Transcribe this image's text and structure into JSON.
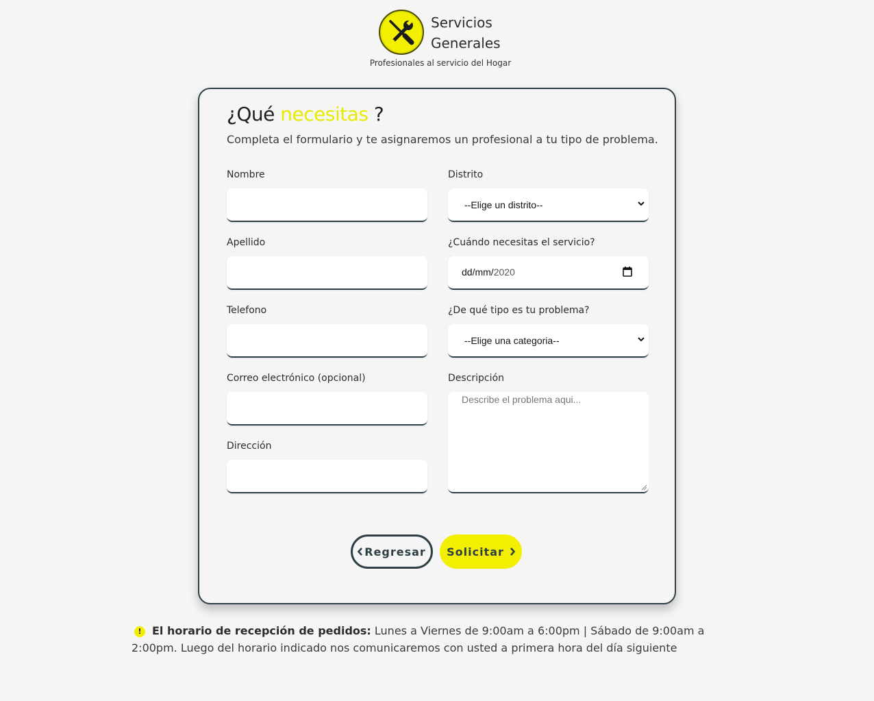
{
  "header": {
    "brand_line1": "Servicios",
    "brand_line2": "Generales",
    "tagline": "Profesionales al servicio del Hogar",
    "logo_icon": "tools-icon",
    "accent_color": "#f2f000"
  },
  "form": {
    "title_prefix": "¿Qué",
    "title_highlight": "necesitas",
    "title_suffix": "?",
    "subtitle": "Completa el formulario y te asignaremos un profesional a tu tipo de problema.",
    "nombre_label": "Nombre",
    "nombre_value": "",
    "apellido_label": "Apellido",
    "apellido_value": "",
    "telefono_label": "Telefono",
    "telefono_value": "",
    "correo_label": "Correo electrónico (opcional)",
    "correo_value": "",
    "direccion_label": "Dirección",
    "direccion_value": "",
    "distrito_label": "Distrito",
    "distrito_selected": "--Elige un distrito--",
    "fecha_label": "¿Cuándo necesitas el servicio?",
    "fecha_day_month": "dd/mm/",
    "fecha_year": "2020",
    "categoria_label": "¿De qué tipo es tu problema?",
    "categoria_selected": "--Elige una categoria--",
    "descripcion_label": "Descripción",
    "descripcion_placeholder": "Describe el problema aqui..."
  },
  "buttons": {
    "back_label": "Regresar",
    "submit_label": "Solicitar"
  },
  "notice": {
    "bold": "El horario de recepción de pedidos:",
    "text": " Lunes a Viernes de 9:00am a 6:00pm | Sábado de 9:00am a 2:00pm. Luego del horario indicado nos comunicaremos con usted a primera hora del día siguiente"
  }
}
